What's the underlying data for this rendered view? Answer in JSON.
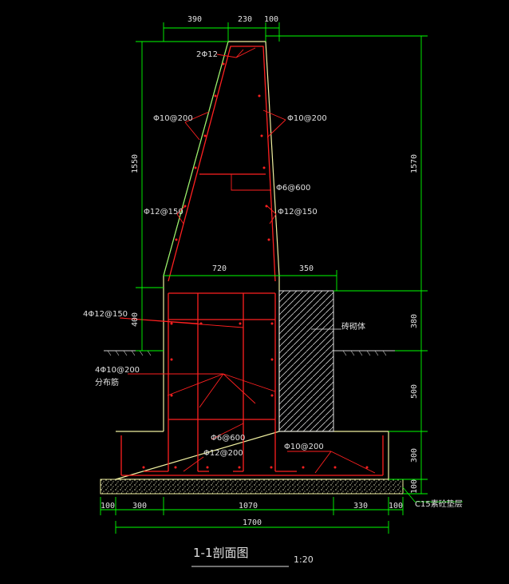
{
  "drawing": {
    "title": "1-1剖面图",
    "scale": "1:20"
  },
  "dimensions": {
    "top": [
      "390",
      "230",
      "100"
    ],
    "mid": [
      "720",
      "350"
    ],
    "bottom": [
      "100",
      "300",
      "1070",
      "330",
      "100"
    ],
    "bottom_total": "1700",
    "left": [
      "1550",
      "400"
    ],
    "right": [
      "1570",
      "380",
      "500",
      "300",
      "100"
    ]
  },
  "annotations": {
    "top_bars": "2Φ12",
    "left_stirrup": "Φ10@200",
    "right_stirrup": "Φ10@200",
    "tie": "Φ6@600",
    "left_vertical": "Φ12@150",
    "right_vertical": "Φ12@150",
    "base_bars": "4Φ12@150",
    "dist_bars": "4Φ10@200",
    "dist_note": "分布筋",
    "lower_tie": "Φ6@600",
    "bottom_bars": "Φ12@200",
    "footing_bars": "Φ10@200",
    "brick": "砖砌体",
    "cushion": "C15素砼垫层"
  },
  "colors": {
    "background": "#000000",
    "outline": "#f0f0a0",
    "rebar": "#ff2020",
    "dimension": "#00ff00",
    "text": "#e0e0e0",
    "hatch": "#ffffff"
  }
}
